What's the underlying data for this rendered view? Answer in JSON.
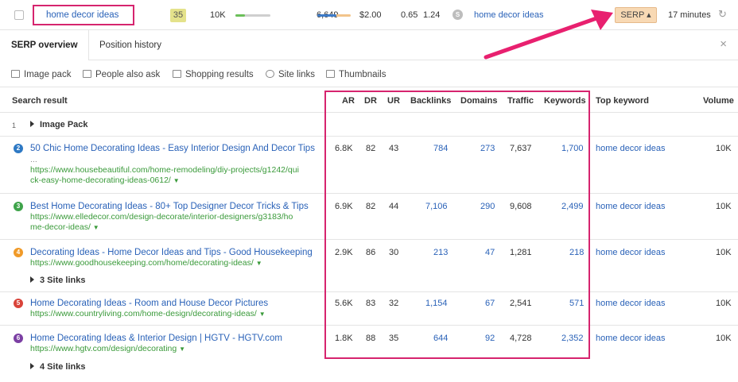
{
  "keyword_row": {
    "keyword": "home decor ideas",
    "kd": "35",
    "volume": "10K",
    "global_volume": "6,649",
    "cpc": "$2.00",
    "cps": "0.65",
    "rr": "1.24",
    "serp_features_icon": "serp-features-icon",
    "parent_keyword": "home decor ideas",
    "serp_button": "SERP ▴",
    "updated": "17 minutes",
    "colors": {
      "highlight": "#d6246e",
      "serp_button_bg": "#f8d9b4",
      "kd_bg": "#e4e28b"
    }
  },
  "tabs": [
    {
      "label": "SERP overview",
      "active": true
    },
    {
      "label": "Position history",
      "active": false
    }
  ],
  "close_icon": "×",
  "filters": [
    {
      "label": "Image pack",
      "icon": "image-icon"
    },
    {
      "label": "People also ask",
      "icon": "chat-icon"
    },
    {
      "label": "Shopping results",
      "icon": "cart-icon"
    },
    {
      "label": "Site links",
      "icon": "link-icon"
    },
    {
      "label": "Thumbnails",
      "icon": "thumbnail-icon"
    }
  ],
  "table": {
    "headers": {
      "search_result": "Search result",
      "ar": "AR",
      "dr": "DR",
      "ur": "UR",
      "backlinks": "Backlinks",
      "domains": "Domains",
      "traffic": "Traffic",
      "keywords": "Keywords",
      "top_keyword": "Top keyword",
      "volume": "Volume"
    },
    "image_pack": {
      "position": "1",
      "label": "Image Pack"
    },
    "rows": [
      {
        "position": "2",
        "badge_color": "#2e79c4",
        "title": "50 Chic Home Decorating Ideas - Easy Interior Design And Decor Tips",
        "extra": "...",
        "url_line1": "https://www.housebeautiful.com/home-remodeling/diy-projects/g1242/qui",
        "url_line2": "ck-easy-home-decorating-ideas-0612/",
        "ar": "6.8K",
        "dr": "82",
        "ur": "43",
        "backlinks": "784",
        "domains": "273",
        "traffic": "7,637",
        "keywords": "1,700",
        "top_keyword": "home decor ideas",
        "volume": "10K"
      },
      {
        "position": "3",
        "badge_color": "#3ea34a",
        "title": "Best Home Decorating Ideas - 80+ Top Designer Decor Tricks & Tips",
        "url_line1": "https://www.elledecor.com/design-decorate/interior-designers/g3183/ho",
        "url_line2": "me-decor-ideas/",
        "ar": "6.9K",
        "dr": "82",
        "ur": "44",
        "backlinks": "7,106",
        "domains": "290",
        "traffic": "9,608",
        "keywords": "2,499",
        "top_keyword": "home decor ideas",
        "volume": "10K"
      },
      {
        "position": "4",
        "badge_color": "#f09a28",
        "title": "Decorating Ideas - Home Decor Ideas and Tips - Good Housekeeping",
        "url_line1": "https://www.goodhousekeeping.com/home/decorating-ideas/",
        "sitelinks": "3 Site links",
        "ar": "2.9K",
        "dr": "86",
        "ur": "30",
        "backlinks": "213",
        "domains": "47",
        "traffic": "1,281",
        "keywords": "218",
        "top_keyword": "home decor ideas",
        "volume": "10K"
      },
      {
        "position": "5",
        "badge_color": "#d9443a",
        "title": "Home Decorating Ideas - Room and House Decor Pictures",
        "url_line1": "https://www.countryliving.com/home-design/decorating-ideas/",
        "ar": "5.6K",
        "dr": "83",
        "ur": "32",
        "backlinks": "1,154",
        "domains": "67",
        "traffic": "2,541",
        "keywords": "571",
        "top_keyword": "home decor ideas",
        "volume": "10K"
      },
      {
        "position": "6",
        "badge_color": "#7b3fa3",
        "title": "Home Decorating Ideas & Interior Design | HGTV - HGTV.com",
        "url_line1": "https://www.hgtv.com/design/decorating",
        "sitelinks": "4 Site links",
        "ar": "1.8K",
        "dr": "88",
        "ur": "35",
        "backlinks": "644",
        "domains": "92",
        "traffic": "4,728",
        "keywords": "2,352",
        "top_keyword": "home decor ideas",
        "volume": "10K"
      }
    ]
  }
}
